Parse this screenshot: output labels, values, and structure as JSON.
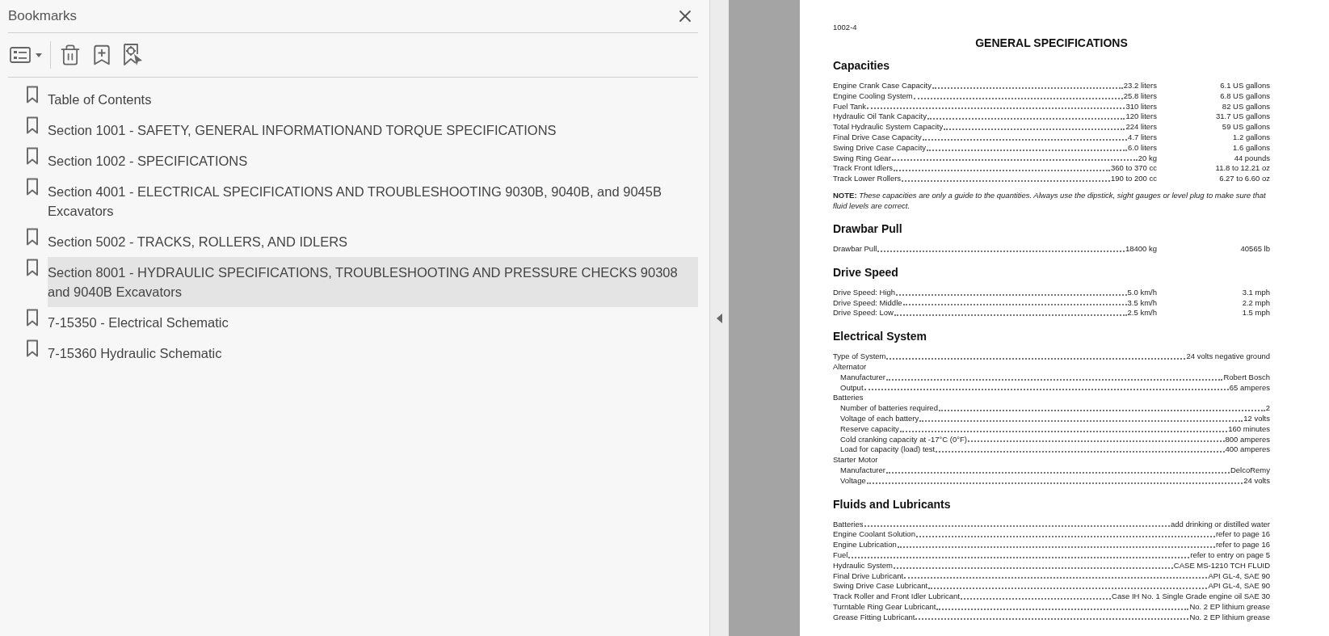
{
  "bookmarks": {
    "title": "Bookmarks",
    "items": [
      {
        "label": "Table of Contents",
        "selected": false
      },
      {
        "label": "Section 1001 - SAFETY, GENERAL INFORMATIONAND TORQUE SPECIFICATIONS",
        "selected": false
      },
      {
        "label": "Section 1002 - SPECIFICATIONS",
        "selected": false
      },
      {
        "label": "Section 4001 - ELECTRICAL SPECIFICATIONS AND TROUBLESHOOTING 9030B, 9040B, and 9045B Excavators",
        "selected": false
      },
      {
        "label": "Section 5002 - TRACKS, ROLLERS, AND IDLERS",
        "selected": false
      },
      {
        "label": "Section 8001 - HYDRAULIC SPECIFICATIONS, TROUBLESHOOTING AND PRESSURE CHECKS 90308 and 9040B Excavators",
        "selected": true
      },
      {
        "label": "7-15350 - Electrical Schematic",
        "selected": false
      },
      {
        "label": "7-15360 Hydraulic Schematic",
        "selected": false
      }
    ]
  },
  "page": {
    "page_number": "1002-4",
    "title": "GENERAL SPECIFICATIONS",
    "sections": [
      {
        "heading": "Capacities",
        "rows": [
          {
            "kind": "item",
            "label": "Engine Crank Case Capacity",
            "value": "23.2 liters",
            "value_2": "6.1 US gallons"
          },
          {
            "kind": "item",
            "label": "Engine Cooling System",
            "value": "25.8 liters",
            "value_2": "6.8 US gallons"
          },
          {
            "kind": "item",
            "label": "Fuel Tank",
            "value": "310 liters",
            "value_2": "82 US gallons"
          },
          {
            "kind": "item",
            "label": "Hydraulic Oil Tank Capacity",
            "value": "120 liters",
            "value_2": "31.7 US gallons"
          },
          {
            "kind": "item",
            "label": "Total Hydraulic System Capacity",
            "value": "224 liters",
            "value_2": "59 US gallons"
          },
          {
            "kind": "item",
            "label": "Final Drive Case Capacity",
            "value": "4.7 liters",
            "value_2": "1.2 gallons"
          },
          {
            "kind": "item",
            "label": "Swing Drive Case Capacity",
            "value": "6.0 liters",
            "value_2": "1.6 gallons"
          },
          {
            "kind": "item",
            "label": "Swing Ring Gear",
            "value": "20 kg",
            "value_2": "44 pounds"
          },
          {
            "kind": "item",
            "label": "Track Front Idlers",
            "value": "360 to 370 cc",
            "value_2": "11.8 to 12.21 oz"
          },
          {
            "kind": "item",
            "label": "Track Lower Rollers",
            "value": "190 to 200 cc",
            "value_2": "6.27 to 6.60 oz"
          }
        ],
        "note": "**NOTE:** *These capacities are only a guide to the quantities. Always use the dipstick, sight gauges or level plug to make sure that fluid levels are correct.*"
      },
      {
        "heading": "Drawbar Pull",
        "rows": [
          {
            "kind": "item",
            "label": "Drawbar Pull",
            "value": "18400 kg",
            "value_2": "40565 lb"
          }
        ]
      },
      {
        "heading": "Drive Speed",
        "rows": [
          {
            "kind": "item",
            "label": "Drive Speed: High",
            "value": "5.0 km/h",
            "value_2": "3.1 mph"
          },
          {
            "kind": "item",
            "label": "Drive Speed: Middle",
            "value": "3.5 km/h",
            "value_2": "2.2 mph"
          },
          {
            "kind": "item",
            "label": "Drive Speed: Low",
            "value": "2.5 km/h",
            "value_2": "1.5 mph"
          }
        ]
      },
      {
        "heading": "Electrical System",
        "rows": [
          {
            "kind": "item",
            "label": "Type of System",
            "value": "24 volts negative ground"
          },
          {
            "kind": "group",
            "label": "Alternator",
            "children": [
              {
                "kind": "item",
                "label": "Manufacturer",
                "value": "Robert Bosch"
              },
              {
                "kind": "item",
                "label": "Output",
                "value": "65 amperes"
              }
            ]
          },
          {
            "kind": "group",
            "label": "Batteries",
            "children": [
              {
                "kind": "item",
                "label": "Number of batteries required",
                "value": "2"
              },
              {
                "kind": "item",
                "label": "Voltage of each battery",
                "value": "12 volts"
              },
              {
                "kind": "item",
                "label": "Reserve capacity",
                "value": "160 minutes"
              },
              {
                "kind": "item",
                "label": "Cold cranking capacity at -17°C (0°F)",
                "value": "800 amperes"
              },
              {
                "kind": "item",
                "label": "Load for capacity (load) test",
                "value": "400 amperes"
              }
            ]
          },
          {
            "kind": "group",
            "label": "Starter Motor",
            "children": [
              {
                "kind": "item",
                "label": "Manufacturer",
                "value": "DelcoRemy"
              },
              {
                "kind": "item",
                "label": "Voltage",
                "value": "24 volts"
              }
            ]
          }
        ]
      },
      {
        "heading": "Fluids and Lubricants",
        "rows": [
          {
            "kind": "item",
            "label": "Batteries",
            "value": "add drinking or distilled water"
          },
          {
            "kind": "item",
            "label": "Engine Coolant Solution",
            "value": "refer to page 16"
          },
          {
            "kind": "item",
            "label": "Engine Lubrication",
            "value": "refer to page 16"
          },
          {
            "kind": "item",
            "label": "Fuel",
            "value": "refer to entry on page 5"
          },
          {
            "kind": "item",
            "label": "Hydraulic System",
            "value": "CASE MS-1210 TCH FLUID"
          },
          {
            "kind": "item",
            "label": "Final Drive Lubricant",
            "value": "API GL-4, SAE 90"
          },
          {
            "kind": "item",
            "label": "Swing Drive Case Lubricant",
            "value": "API GL-4, SAE 90"
          },
          {
            "kind": "item",
            "label": "Track Roller and Front Idler Lubricant",
            "value": "Case IH No. 1 Single Grade engine oil SAE 30"
          },
          {
            "kind": "item",
            "label": "Turntable Ring Gear Lubricant",
            "value": "No. 2 EP lithium grease"
          },
          {
            "kind": "item",
            "label": "Grease Fitting Lubricant",
            "value": "No. 2 EP lithium grease"
          }
        ]
      }
    ]
  }
}
